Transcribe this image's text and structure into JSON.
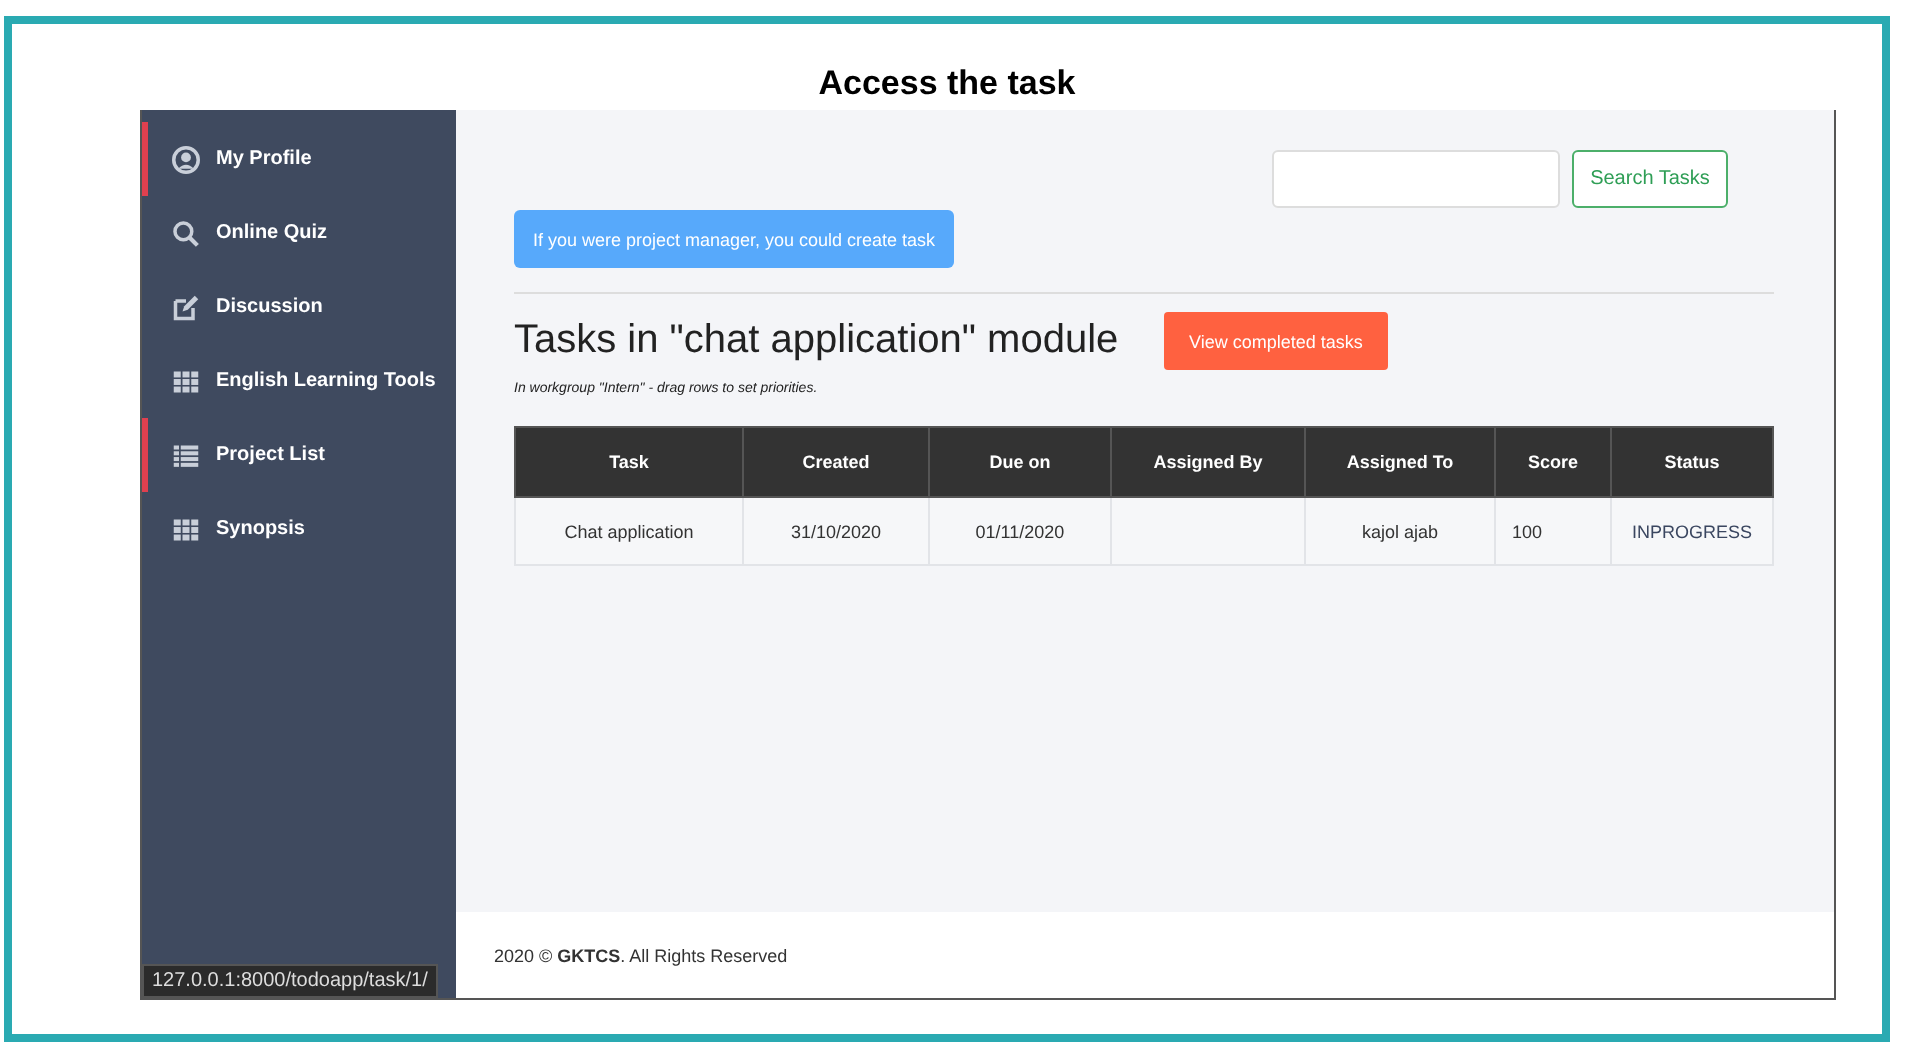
{
  "title": "Access the task",
  "sidebar": {
    "items": [
      {
        "label": "My Profile",
        "selected": true
      },
      {
        "label": "Online Quiz",
        "selected": false
      },
      {
        "label": "Discussion",
        "selected": false
      },
      {
        "label": "English Learning Tools",
        "selected": false
      },
      {
        "label": "Project List",
        "selected": true
      },
      {
        "label": "Synopsis",
        "selected": false
      }
    ]
  },
  "search_button": "Search Tasks",
  "create_notice": "If you were project manager, you could create task",
  "heading": "Tasks in \"chat application\" module",
  "completed_button": "View completed tasks",
  "subtitle": "In workgroup \"Intern\" - drag rows to set priorities.",
  "table": {
    "columns": [
      "Task",
      "Created",
      "Due on",
      "Assigned By",
      "Assigned To",
      "Score",
      "Status"
    ],
    "rows": [
      [
        "Chat application",
        "31/10/2020",
        "01/11/2020",
        "",
        "kajol ajab",
        "100",
        "INPROGRESS"
      ]
    ]
  },
  "footer": "2020 © **GKTCS**. All Rights Reserved",
  "status_url": "127.0.0.1:8000/todoapp/task/1/"
}
